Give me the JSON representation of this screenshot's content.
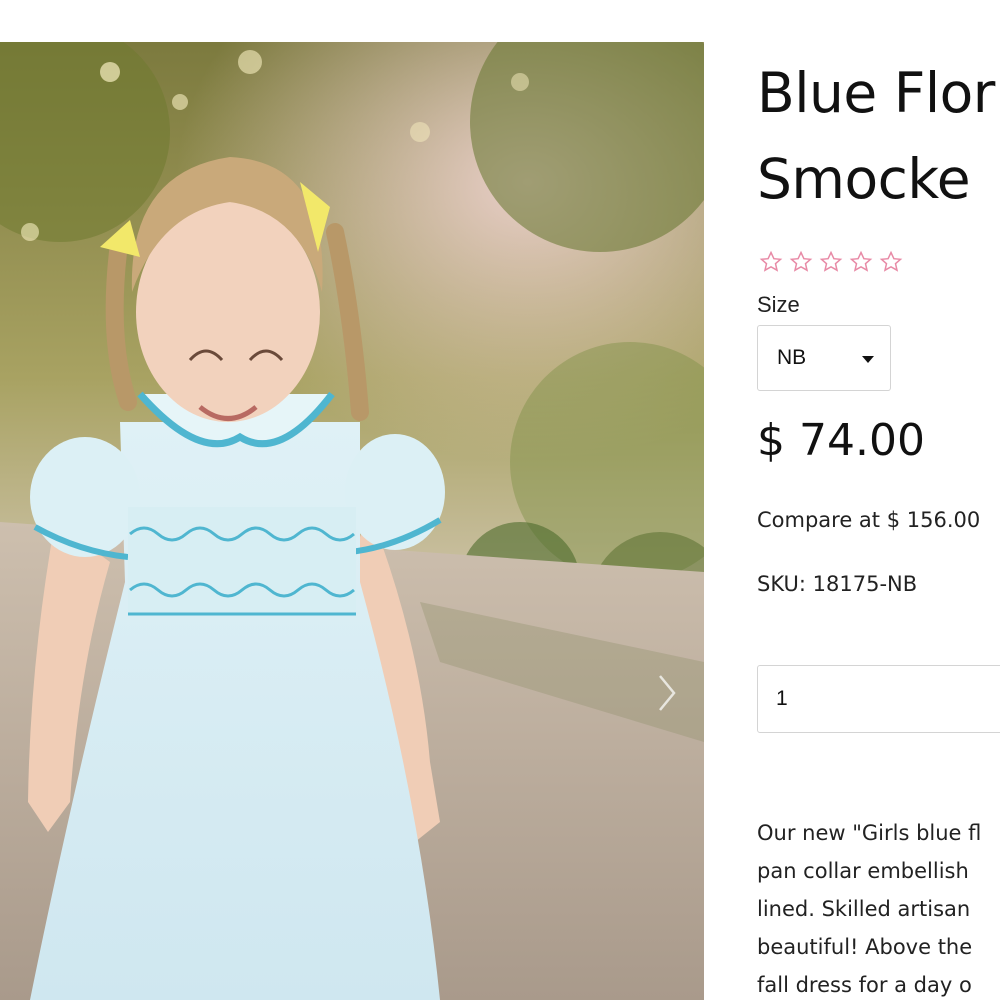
{
  "product": {
    "title_line1": "Blue Flor",
    "title_line2": "Smocke",
    "rating_stars": 0,
    "star_color": "#e88aa6",
    "size_label": "Size",
    "size_selected": "NB",
    "price": "$ 74.00",
    "compare_at": "Compare at $ 156.00",
    "sku": "SKU: 18175-NB",
    "quantity": "1",
    "description_lines": [
      "Our new \"Girls blue fl",
      "pan collar embellish",
      "lined.  Skilled artisan",
      "beautiful! Above the",
      "fall dress for a day o"
    ]
  },
  "gallery": {
    "next_icon": "chevron-right-icon",
    "accent_color": "#4fb6d0"
  }
}
